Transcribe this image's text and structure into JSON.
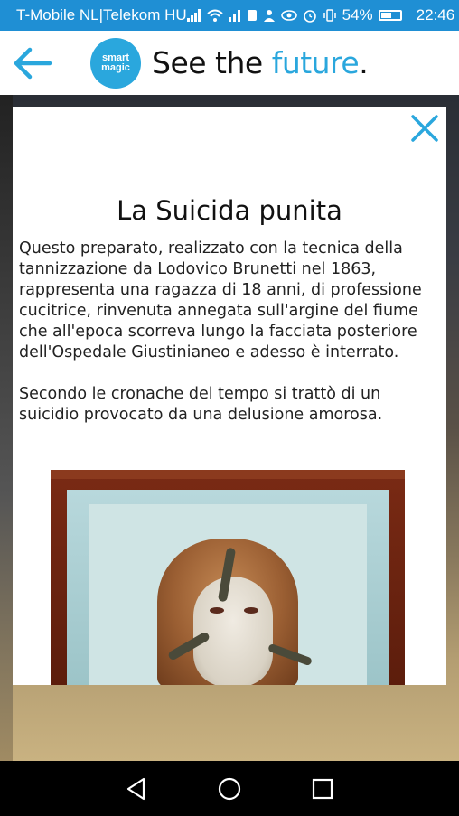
{
  "status_bar": {
    "carrier": "T-Mobile NL|Telekom HU",
    "battery": "54%",
    "time": "22:46"
  },
  "header": {
    "logo_line1": "smart",
    "logo_line2": "magic",
    "tagline_main": "See the ",
    "tagline_accent": "future",
    "tagline_end": "."
  },
  "article": {
    "title": "La Suicida punita",
    "paragraph1": "Questo preparato, realizzato con la tecnica della tannizzazione da Lodovico Brunetti nel 1863, rappresenta una ragazza di 18 anni, di professione cucitrice, rinvenuta annegata sull'argine del fiume che all'epoca scorreva lungo la facciata posteriore dell'Ospedale Giustinianeo e adesso è interrato.",
    "paragraph2": "Secondo le cronache del tempo si trattò di un suicidio provocato da una delusione amorosa."
  },
  "colors": {
    "accent": "#2aa7dd",
    "status_bar": "#1f8fd4"
  }
}
